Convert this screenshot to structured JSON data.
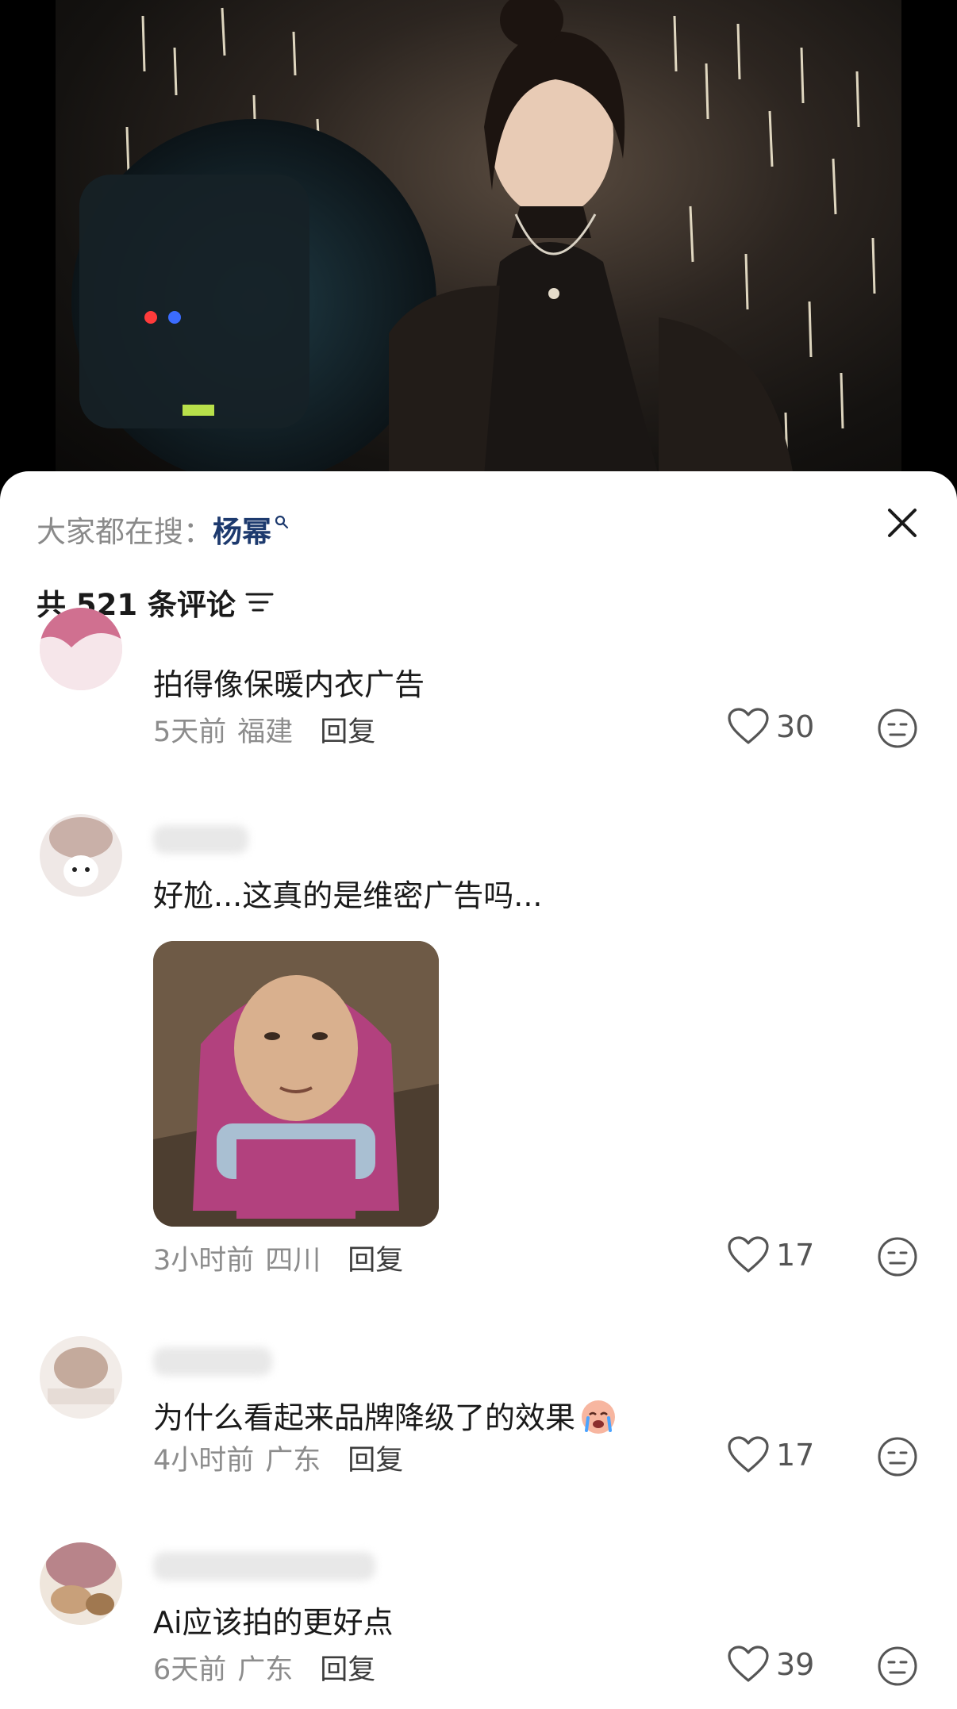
{
  "hot_search": {
    "prefix": "大家都在搜：",
    "term": "杨幂"
  },
  "comments_header": {
    "count_text": "共 521 条评论"
  },
  "comments": [
    {
      "text": "拍得像保暖内衣广告",
      "time": "5天前",
      "location": "福建",
      "reply": "回复",
      "likes": "30"
    },
    {
      "text": "好尬...这真的是维密广告吗...",
      "time": "3小时前",
      "location": "四川",
      "reply": "回复",
      "likes": "17"
    },
    {
      "text": "为什么看起来品牌降级了的效果",
      "time": "4小时前",
      "location": "广东",
      "reply": "回复",
      "likes": "17"
    },
    {
      "text": "Ai应该拍的更好点",
      "time": "6天前",
      "location": "广东",
      "reply": "回复",
      "likes": "39"
    }
  ],
  "icons": {
    "search": "search-icon",
    "close": "close-icon",
    "sort": "sort-icon",
    "like": "heart-icon",
    "dislike": "dislike-face-icon",
    "crying_emoji": "crying-face-emoji"
  },
  "colors": {
    "hot_term": "#1d3a6e",
    "meta_text": "#8c8c8c",
    "sheet_bg": "#ffffff"
  }
}
